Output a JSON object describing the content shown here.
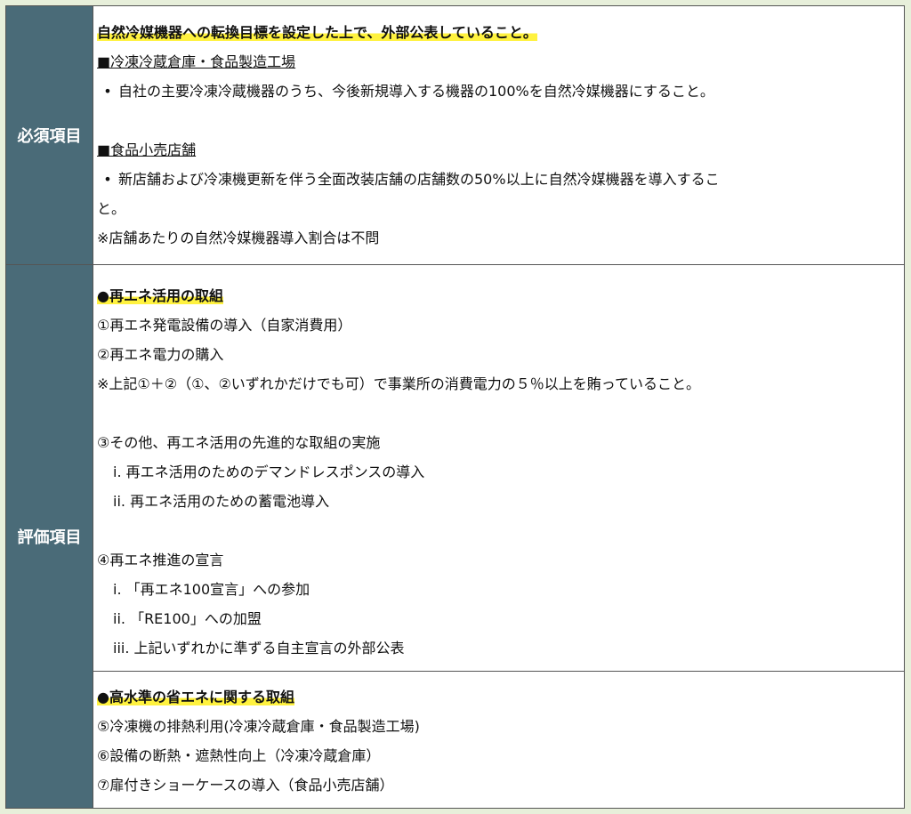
{
  "required": {
    "label": "必須項目",
    "heading": "自然冷媒機器への転換目標を設定した上で、外部公表していること。",
    "section1_title": "■冷凍冷蔵倉庫・食品製造工場",
    "section1_bullet": "自社の主要冷凍冷蔵機器のうち、今後新規導入する機器の100%を自然冷媒機器にすること。",
    "section2_title": "■食品小売店舗",
    "section2_bullet": "新店舗および冷凍機更新を伴う全面改装店舗の店舗数の50%以上に自然冷媒機器を導入するこ",
    "section2_bullet_cont": "と。",
    "note": "※店舗あたりの自然冷媒機器導入割合は不問"
  },
  "evaluation": {
    "label": "評価項目",
    "group1_heading": "●再エネ活用の取組",
    "group1_items": [
      "①再エネ発電設備の導入（自家消費用）",
      "②再エネ電力の購入",
      "※上記①＋②（①、②いずれかだけでも可）で事業所の消費電力の５％以上を賄っていること。",
      "③その他、再エネ活用の先進的な取組の実施",
      "i. 再エネ活用のためのデマンドレスポンスの導入",
      "ii. 再エネ活用のための蓄電池導入",
      "④再エネ推進の宣言",
      "i. 「再エネ100宣言」への参加",
      "ii. 「RE100」への加盟",
      "iii. 上記いずれかに準ずる自主宣言の外部公表"
    ],
    "group2_heading": "●高水準の省エネに関する取組",
    "group2_items": [
      "⑤冷凍機の排熱利用(冷凍冷蔵倉庫・食品製造工場)",
      "⑥設備の断熱・遮熱性向上（冷凍冷蔵倉庫）",
      "⑦扉付きショーケースの導入（食品小売店舗）"
    ]
  },
  "colors": {
    "label_bg": "#4a6b78",
    "highlight": "#fff23f",
    "page_bg": "#e7efda"
  }
}
